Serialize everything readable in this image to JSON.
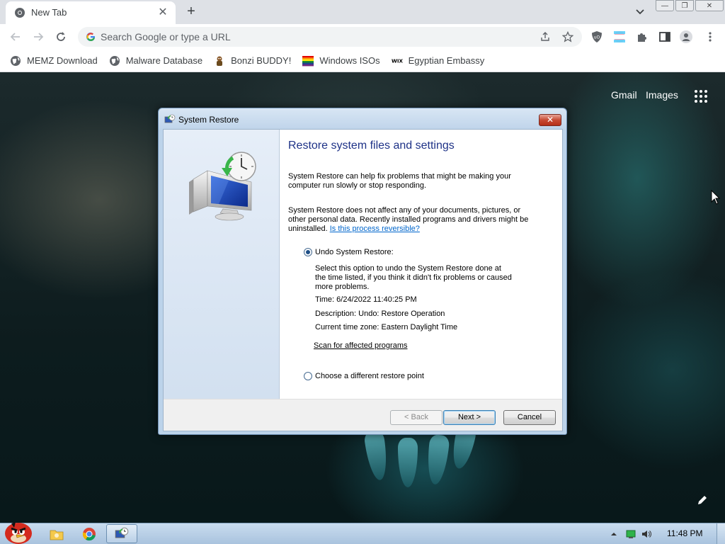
{
  "browser": {
    "tab": {
      "title": "New Tab",
      "close": "✕"
    },
    "new_tab": "+",
    "omnibox": {
      "placeholder": "Search Google or type a URL"
    },
    "bookmarks": [
      {
        "label": "MEMZ Download",
        "icon": "globe-icon"
      },
      {
        "label": "Malware Database",
        "icon": "globe-icon"
      },
      {
        "label": "Bonzi BUDDY!",
        "icon": "bonzi-icon"
      },
      {
        "label": "Windows ISOs",
        "icon": "rainbow-flag-icon"
      },
      {
        "label": "Egyptian Embassy",
        "icon": "wix-icon",
        "icon_text": "WIX"
      }
    ],
    "window_controls": {
      "minimize": "—",
      "restore": "❐",
      "close": "✕"
    }
  },
  "ntp": {
    "gmail": "Gmail",
    "images": "Images"
  },
  "dialog": {
    "title": "System Restore",
    "close": "✕",
    "heading": "Restore system files and settings",
    "para1_line1": "System Restore can help fix problems that might be making your",
    "para1_line2": "computer run slowly or stop responding.",
    "para2_line1": "System Restore does not affect any of your documents, pictures, or",
    "para2_line2": "other personal data. Recently installed programs and drivers might be",
    "para2_line3": "uninstalled.",
    "para2_link": "Is this process reversible?",
    "option_undo": "Undo System Restore:",
    "undo_desc_line1": "Select this option to undo the System Restore done at",
    "undo_desc_line2": "the time listed, if you think it didn't fix problems or caused",
    "undo_desc_line3": "more problems.",
    "time": "Time: 6/24/2022 11:40:25 PM",
    "description": "Description: Undo: Restore Operation",
    "timezone": "Current time zone: Eastern Daylight Time",
    "scan_link": "Scan for affected programs",
    "option_different": "Choose a different restore point",
    "buttons": {
      "back": "< Back",
      "next": "Next >",
      "cancel": "Cancel"
    }
  },
  "taskbar": {
    "clock": "11:48 PM"
  },
  "colors": {
    "heading": "#1e3287",
    "link": "#0066cc",
    "close_red": "#c74a34"
  }
}
